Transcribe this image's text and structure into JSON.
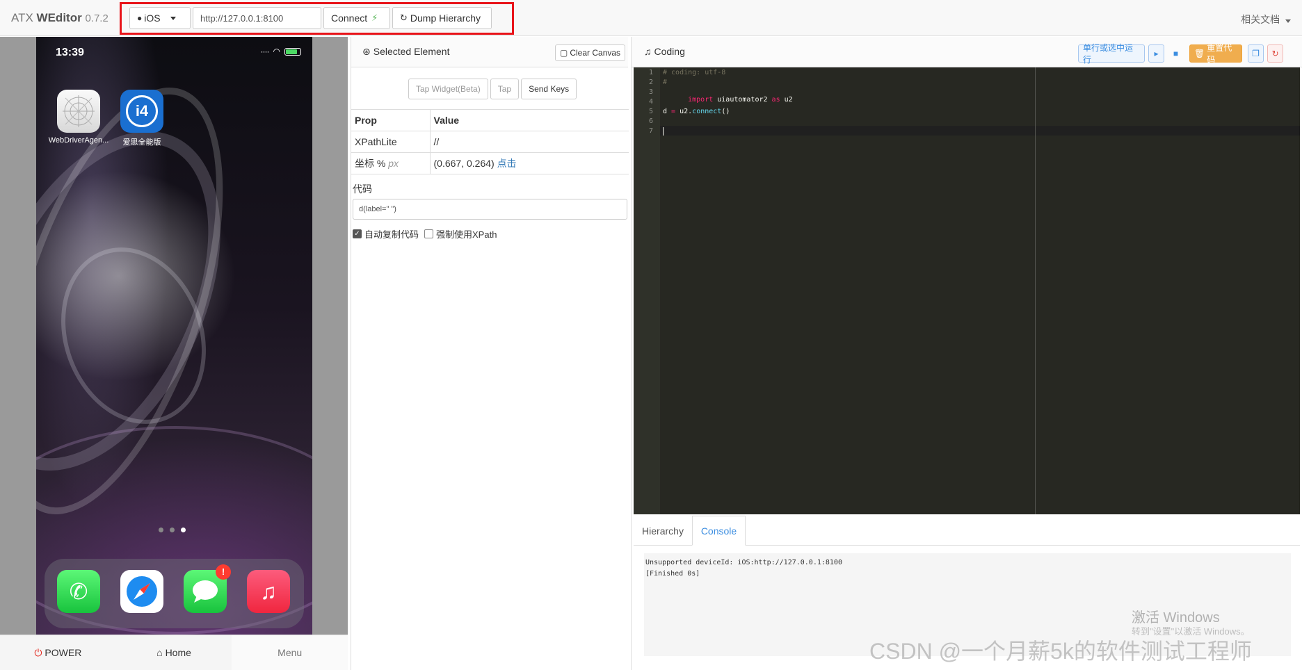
{
  "navbar": {
    "brand_prefix": "ATX",
    "brand_name": "WEditor",
    "version": "0.7.2",
    "platform_select": "iOS",
    "device_url": "http://127.0.0.1:8100",
    "connect_label": "Connect",
    "dump_label": "Dump Hierarchy",
    "docs_label": "相关文档",
    "highlight_color": "#e8141a"
  },
  "phone": {
    "status_time": "13:39",
    "apps": [
      {
        "label": "WebDriverAgen...",
        "icon": "webdriveragent-icon"
      },
      {
        "label": "爱思全能版",
        "icon": "i4-app-icon"
      }
    ],
    "page_dots": 3,
    "active_dot": 3,
    "dock_apps": [
      "phone-icon",
      "safari-icon",
      "messages-icon",
      "music-icon"
    ],
    "messages_badge": "!",
    "power_label": "POWER",
    "home_label": "Home",
    "menu_label": "Menu"
  },
  "inspector": {
    "title": "Selected Element",
    "clear_canvas_label": "Clear Canvas",
    "tap_widget_label": "Tap Widget(Beta)",
    "tap_label": "Tap",
    "send_keys_label": "Send Keys",
    "table_header": {
      "prop": "Prop",
      "value": "Value"
    },
    "rows": [
      {
        "prop": "XPathLite",
        "value": "//"
      },
      {
        "prop": "坐标 %",
        "prop_suffix": "px",
        "value": "(0.667, 0.264)",
        "action": "点击"
      }
    ],
    "code_label": "代码",
    "code_value": "d(label=\" \")",
    "auto_copy_label": "自动复制代码",
    "auto_copy_checked": true,
    "force_xpath_label": "强制使用XPath",
    "force_xpath_checked": false
  },
  "coding": {
    "title": "Coding",
    "run_line_label": "单行或选中运行",
    "reset_code_label": "重置代码",
    "lines": [
      {
        "n": "1",
        "text": "# coding: utf-8"
      },
      {
        "n": "2",
        "text": "#"
      },
      {
        "n": "3",
        "text": "import uiautomator2 as u2"
      },
      {
        "n": "4",
        "text": ""
      },
      {
        "n": "5",
        "text": "d = u2.connect()"
      },
      {
        "n": "6",
        "text": ""
      },
      {
        "n": "7",
        "text": ""
      }
    ],
    "tabs": [
      {
        "label": "Hierarchy",
        "active": false
      },
      {
        "label": "Console",
        "active": true
      }
    ],
    "console_lines": [
      "Unsupported deviceId: iOS:http://127.0.0.1:8100",
      "[Finished 0s]"
    ]
  },
  "watermarks": {
    "windows_title": "激活 Windows",
    "windows_sub": "转到\"设置\"以激活 Windows。",
    "csdn": "CSDN @一个月薪5k的软件测试工程师"
  }
}
